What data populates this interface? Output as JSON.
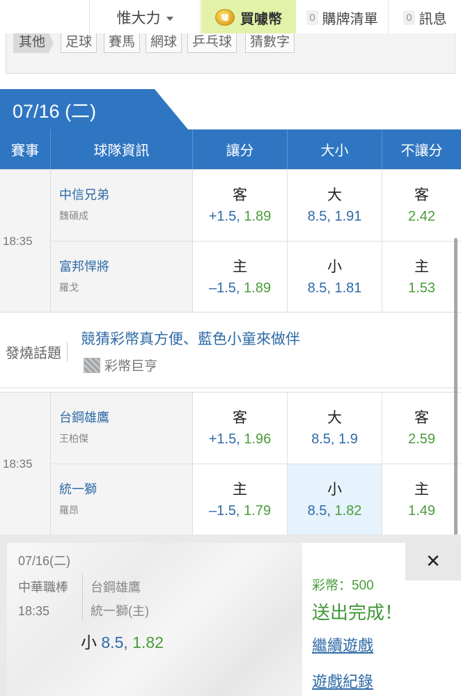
{
  "header": {
    "user_name": "惟大力",
    "buy_label": "買噱幣",
    "coin_icon_text": "噱",
    "cart_count": "0",
    "cart_label": "購牌清單",
    "msg_count": "0",
    "msg_label": "訊息"
  },
  "categories": {
    "other_label": "其他",
    "items": [
      "足球",
      "賽馬",
      "網球",
      "乒乓球",
      "猜數字"
    ]
  },
  "date_tab": "07/16 (二)",
  "columns": [
    "賽事",
    "球隊資訊",
    "讓分",
    "大小",
    "不讓分"
  ],
  "matches": [
    {
      "time": "18:35",
      "away": {
        "team": "中信兄弟",
        "pitcher": "魏碩成",
        "spread_side": "客",
        "spread_line": "+1.5,",
        "spread_odds": "1.89",
        "total_side": "大",
        "total_line": "8.5,",
        "total_odds": "1.91",
        "ml_side": "客",
        "ml_odds": "2.42"
      },
      "home": {
        "team": "富邦悍將",
        "pitcher": "羅戈",
        "spread_side": "主",
        "spread_line": "–1.5,",
        "spread_odds": "1.89",
        "total_side": "小",
        "total_line": "8.5,",
        "total_odds": "1.81",
        "ml_side": "主",
        "ml_odds": "1.53"
      }
    },
    {
      "time": "18:35",
      "away": {
        "team": "台鋼雄鷹",
        "pitcher": "王柏傑",
        "spread_side": "客",
        "spread_line": "+1.5,",
        "spread_odds": "1.96",
        "total_side": "大",
        "total_line": "8.5,",
        "total_odds": "1.9",
        "ml_side": "客",
        "ml_odds": "2.59"
      },
      "home": {
        "team": "統一獅",
        "pitcher": "羅昂",
        "spread_side": "主",
        "spread_line": "–1.5,",
        "spread_odds": "1.79",
        "total_side": "小",
        "total_line": "8.5,",
        "total_odds": "1.82",
        "ml_side": "主",
        "ml_odds": "1.49"
      }
    }
  ],
  "hot_topic": {
    "label": "發燒話題",
    "title": "競猜彩幣真方便、藍色小童來做伴",
    "author": "彩幣巨亨"
  },
  "bet_slip": {
    "date": "07/16(二)",
    "league": "中華職棒",
    "time": "18:35",
    "team_a": "台鋼雄鷹",
    "team_b": "統一獅(主)",
    "pick_side": "小",
    "pick_line": "8.5,",
    "pick_odds": "1.82",
    "coins_text": "彩幣：500",
    "done_text": "送出完成！",
    "continue_label": "繼續遊戲",
    "history_label": "遊戲紀錄",
    "close_symbol": "✕"
  },
  "colors": {
    "header_blue": "#2f76c2",
    "link_blue": "#2e6aa6",
    "odds_green": "#4a9c3a",
    "buy_bg": "#e2f2a8",
    "selected_bg": "#e6f3fc"
  }
}
